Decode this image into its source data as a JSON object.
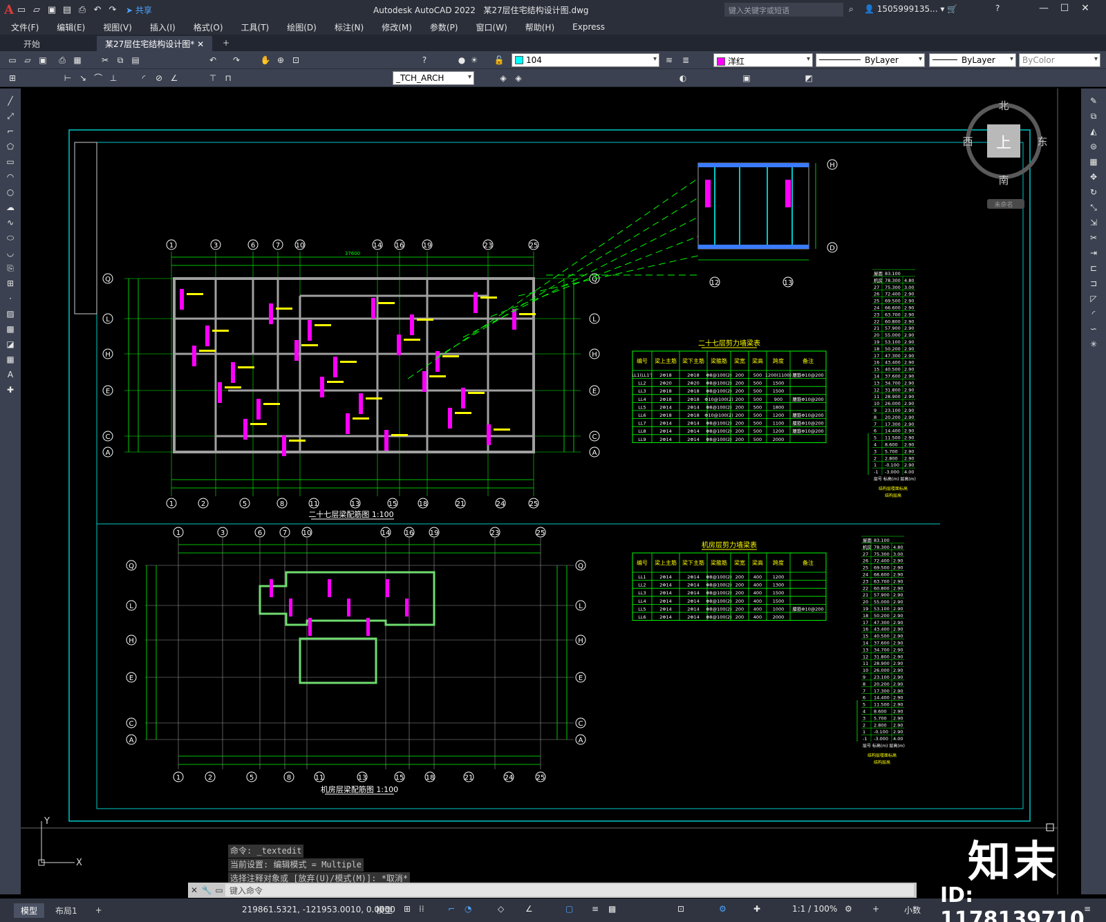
{
  "title_bar": {
    "app_title": "Autodesk AutoCAD 2022",
    "file_name": "某27层住宅结构设计图.dwg",
    "share_label": "共享",
    "search_placeholder": "键入关键字或短语",
    "account": "1505999135...",
    "help_icon": "question-icon"
  },
  "menu": [
    "文件(F)",
    "编辑(E)",
    "视图(V)",
    "插入(I)",
    "格式(O)",
    "工具(T)",
    "绘图(D)",
    "标注(N)",
    "修改(M)",
    "参数(P)",
    "窗口(W)",
    "帮助(H)",
    "Express"
  ],
  "tabs": [
    {
      "label": "开始",
      "active": false
    },
    {
      "label": "某27层住宅结构设计图*",
      "active": true
    }
  ],
  "toolbar": {
    "layer": "104",
    "color": "洋红",
    "color_hex": "#ff00ff",
    "linetype": "ByLayer",
    "lineweight": "ByLayer",
    "plotstyle": "ByColor",
    "text_style": "_TCH_ARCH"
  },
  "viewcube": {
    "north": "北",
    "south": "南",
    "east": "东",
    "west": "西",
    "top": "上",
    "wcs": "未命名"
  },
  "drawing": {
    "plan1_title": "二十七层梁配筋图",
    "plan1_scale": "1:100",
    "plan2_title": "机房层梁配筋图",
    "plan2_scale": "1:100",
    "table1_title": "二十七层剪力墙梁表",
    "table2_title": "机房层剪力墙梁表",
    "table_headers": [
      "编号",
      "梁上主筋",
      "梁下主筋",
      "梁箍筋",
      "梁宽",
      "梁高",
      "跨度",
      "备注"
    ],
    "table1_rows": [
      [
        "LL1(LL1')",
        "2Φ18",
        "2Φ18",
        "Φ8@100(2)",
        "200",
        "500",
        "1200(1100)",
        "腰筋Φ10@200"
      ],
      [
        "LL2",
        "2Φ20",
        "2Φ20",
        "Φ8@100(2)",
        "200",
        "500",
        "1500",
        ""
      ],
      [
        "LL3",
        "2Φ18",
        "2Φ18",
        "Φ8@100(2)",
        "200",
        "500",
        "1500",
        ""
      ],
      [
        "LL4",
        "2Φ18",
        "2Φ18",
        "Φ10@100(2)",
        "200",
        "500",
        "900",
        "腰筋Φ10@200"
      ],
      [
        "LL5",
        "2Φ14",
        "2Φ14",
        "Φ8@100(2)",
        "200",
        "500",
        "1800",
        ""
      ],
      [
        "LL6",
        "2Φ18",
        "2Φ18",
        "Φ10@100(2)",
        "200",
        "500",
        "1200",
        "腰筋Φ10@200"
      ],
      [
        "LL7",
        "2Φ14",
        "2Φ14",
        "Φ8@100(2)",
        "200",
        "500",
        "1100",
        "腰筋Φ10@200"
      ],
      [
        "LL8",
        "2Φ14",
        "2Φ14",
        "Φ8@100(2)",
        "200",
        "500",
        "1200",
        "腰筋Φ10@200"
      ],
      [
        "LL9",
        "2Φ14",
        "2Φ14",
        "Φ8@100(2)",
        "200",
        "500",
        "2000",
        ""
      ]
    ],
    "table2_rows": [
      [
        "LL1",
        "2Φ14",
        "2Φ14",
        "Φ8@100(2)",
        "200",
        "400",
        "1200",
        ""
      ],
      [
        "LL2",
        "2Φ14",
        "2Φ14",
        "Φ8@100(2)",
        "200",
        "400",
        "1300",
        ""
      ],
      [
        "LL3",
        "2Φ14",
        "2Φ14",
        "Φ8@100(2)",
        "200",
        "400",
        "1500",
        ""
      ],
      [
        "LL4",
        "2Φ14",
        "2Φ14",
        "Φ8@100(2)",
        "200",
        "400",
        "1500",
        ""
      ],
      [
        "LL5",
        "2Φ14",
        "2Φ14",
        "Φ8@100(2)",
        "200",
        "400",
        "1000",
        "腰筋Φ10@200"
      ],
      [
        "LL6",
        "2Φ14",
        "2Φ14",
        "Φ8@100(2)",
        "200",
        "400",
        "2000",
        ""
      ]
    ],
    "axis_top": [
      "1",
      "3",
      "6",
      "7",
      "10",
      "14",
      "16",
      "19",
      "23",
      "25"
    ],
    "axis_bottom": [
      "1",
      "2",
      "5",
      "8",
      "11",
      "13",
      "15",
      "18",
      "21",
      "24",
      "25"
    ],
    "axis_rows": [
      "Q",
      "L",
      "H",
      "E",
      "C",
      "A"
    ],
    "detail_axes": [
      "12",
      "13"
    ],
    "detail_rows": [
      "H",
      "D"
    ],
    "dim_total": "37600",
    "elev_rows": [
      [
        "屋面",
        "83.100",
        ""
      ],
      [
        "机房",
        "78.300",
        "4.80"
      ],
      [
        "27",
        "75.300",
        "3.00"
      ],
      [
        "26",
        "72.400",
        "2.90"
      ],
      [
        "25",
        "69.500",
        "2.90"
      ],
      [
        "24",
        "66.600",
        "2.90"
      ],
      [
        "23",
        "63.700",
        "2.90"
      ],
      [
        "22",
        "60.800",
        "2.90"
      ],
      [
        "21",
        "57.900",
        "2.90"
      ],
      [
        "20",
        "55.000",
        "2.90"
      ],
      [
        "19",
        "53.100",
        "2.90"
      ],
      [
        "18",
        "50.200",
        "2.90"
      ],
      [
        "17",
        "47.300",
        "2.90"
      ],
      [
        "16",
        "43.400",
        "2.90"
      ],
      [
        "15",
        "40.500",
        "2.90"
      ],
      [
        "14",
        "37.600",
        "2.90"
      ],
      [
        "13",
        "34.700",
        "2.90"
      ],
      [
        "12",
        "31.800",
        "2.90"
      ],
      [
        "11",
        "28.900",
        "2.90"
      ],
      [
        "10",
        "26.000",
        "2.90"
      ],
      [
        "9",
        "23.100",
        "2.90"
      ],
      [
        "8",
        "20.200",
        "2.90"
      ],
      [
        "7",
        "17.300",
        "2.90"
      ],
      [
        "6",
        "14.400",
        "2.90"
      ],
      [
        "5",
        "11.500",
        "2.90"
      ],
      [
        "4",
        "8.600",
        "2.90"
      ],
      [
        "3",
        "5.700",
        "2.90"
      ],
      [
        "2",
        "2.800",
        "2.90"
      ],
      [
        "1",
        "-0.100",
        "2.90"
      ],
      [
        "-1",
        "-3.000",
        "4.00"
      ]
    ],
    "elev_footer": "层号  标高(m)  层高(m)",
    "elev_caption": "结构层楼面标高",
    "elev_caption2": "结构层高"
  },
  "command": {
    "history": [
      "命令: _textedit",
      "当前设置: 编辑模式 = Multiple",
      "选择注释对象或 [放弃(U)/模式(M)]: *取消*"
    ],
    "prompt": "键入命令"
  },
  "status": {
    "layouts": [
      "模型",
      "布局1"
    ],
    "coords": "219861.5321, -121953.0010, 0.0000",
    "space": "模型",
    "scale": "1:1 / 100%",
    "units": "小数"
  },
  "watermark": {
    "logo": "知末",
    "id": "ID: 1178139710"
  },
  "colors": {
    "ui_dark": "#2b2f3a",
    "toolbar": "#3b4150",
    "canvas": "#000000",
    "frame": "#00c8c8",
    "axis": "#00ff00",
    "wall": "#a0a0a0",
    "text_yellow": "#ffff00",
    "text_magenta": "#ff00ff",
    "table_line": "#00ff00"
  }
}
